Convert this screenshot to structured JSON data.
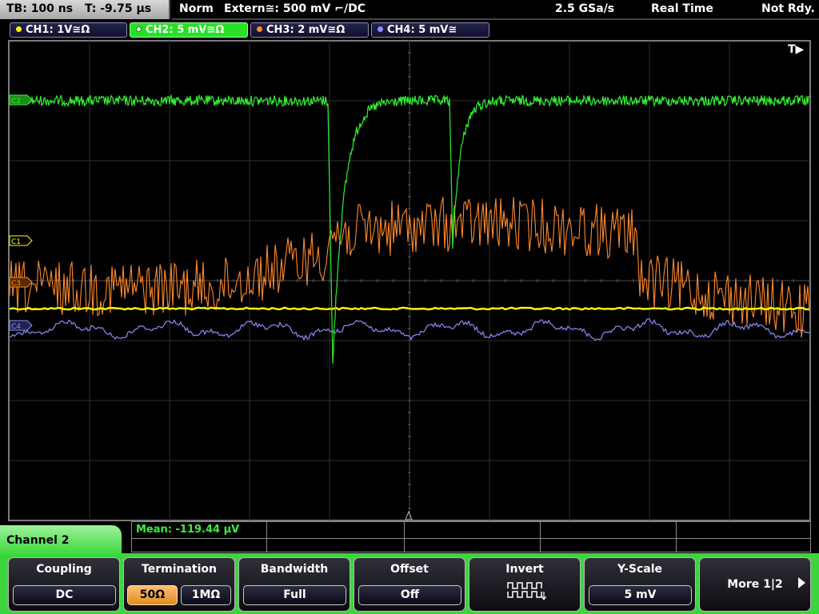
{
  "status": {
    "timebase": "TB: 100 ns",
    "trigger_time": "T: -9.75 µs",
    "mode": "Norm",
    "trigger_source": "Extern≅: 500 mV ⌐/DC",
    "sample_rate": "2.5 GSa/s",
    "acquisition": "Real Time",
    "state": "Not Rdy."
  },
  "channels": [
    {
      "label": "CH1: 1V≅Ω",
      "color": "#ffff00",
      "active": false
    },
    {
      "label": "CH2: 5 mV≅Ω",
      "color": "#28e028",
      "active": true
    },
    {
      "label": "CH3: 2 mV≅Ω",
      "color": "#ff8a2a",
      "active": false
    },
    {
      "label": "CH4: 5 mV≅",
      "color": "#8f8fff",
      "active": false
    }
  ],
  "markers": {
    "c1": "C1",
    "c2": "C2",
    "c3": "C3",
    "c4": "C4",
    "trigger": "T▶"
  },
  "measurement": {
    "mean": "Mean: -119.44 µV"
  },
  "panel": {
    "title": "Channel 2"
  },
  "softkeys": {
    "coupling": {
      "title": "Coupling",
      "value": "DC"
    },
    "termination": {
      "title": "Termination",
      "option1": "50Ω",
      "option2": "1MΩ",
      "selected": "50Ω"
    },
    "bandwidth": {
      "title": "Bandwidth",
      "value": "Full"
    },
    "offset": {
      "title": "Offset",
      "value": "Off"
    },
    "invert": {
      "title": "Invert",
      "icon": "invert-waveform-icon"
    },
    "yscale": {
      "title": "Y-Scale",
      "value": "5 mV"
    },
    "more": {
      "label": "More 1|2",
      "icon": "arrow-right-icon"
    }
  }
}
